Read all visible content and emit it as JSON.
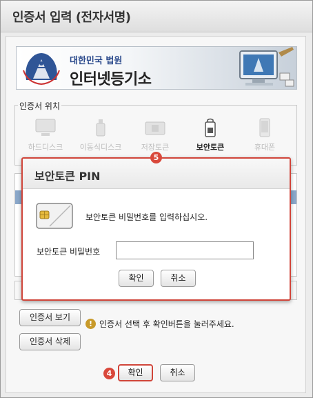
{
  "window": {
    "title": "인증서 입력 (전자서명)"
  },
  "banner": {
    "subtitle": "대한민국 법원",
    "title": "인터넷등기소",
    "emblem_text": "대한민국법원"
  },
  "location": {
    "legend": "인증서 위치",
    "items": [
      {
        "label": "하드디스크",
        "icon": "hard-disk-icon",
        "active": false
      },
      {
        "label": "이동식디스크",
        "icon": "usb-drive-icon",
        "active": false
      },
      {
        "label": "저장토큰",
        "icon": "storage-token-icon",
        "active": false
      },
      {
        "label": "보안토큰",
        "icon": "security-token-icon",
        "active": true
      },
      {
        "label": "휴대폰",
        "icon": "mobile-phone-icon",
        "active": false
      }
    ]
  },
  "cert_actions": {
    "view_label": "인증서 보기",
    "delete_label": "인증서 삭제",
    "notice": "인증서 선택 후 확인버튼을 눌러주세요."
  },
  "footer": {
    "confirm_label": "확인",
    "cancel_label": "취소",
    "step_badge": "4"
  },
  "pin_dialog": {
    "title": "보안토큰 PIN",
    "step_badge": "5",
    "message": "보안토큰 비밀번호를 입력하십시오.",
    "field_label": "보안토큰 비밀번호",
    "field_value": "",
    "confirm_label": "확인",
    "cancel_label": "취소"
  },
  "colors": {
    "accent": "#d0453a",
    "badge": "#d9483b",
    "selection": "#8aa7c9",
    "brand": "#2b4a8c"
  }
}
